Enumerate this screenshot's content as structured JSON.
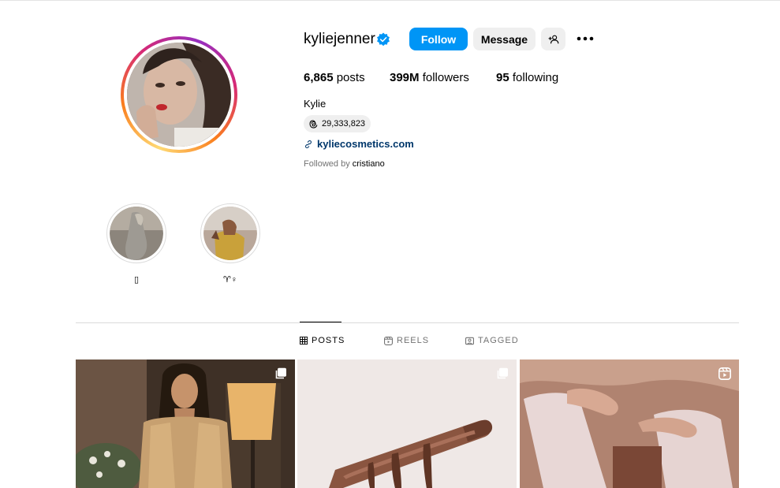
{
  "profile": {
    "username": "kyliejenner",
    "verified_icon": "verified-badge-icon",
    "full_name": "Kylie",
    "threads_count": "29,333,823",
    "link": "kyliecosmetics.com",
    "followed_by_prefix": "Followed by",
    "followed_by_user": "cristiano"
  },
  "actions": {
    "follow_label": "Follow",
    "message_label": "Message",
    "add_user_icon": "add-user-icon",
    "more_icon": "more-options-icon"
  },
  "stats": {
    "posts_num": "6,865",
    "posts_label": "posts",
    "followers_num": "399M",
    "followers_label": "followers",
    "following_num": "95",
    "following_label": "following"
  },
  "highlights": [
    {
      "label": "▯"
    },
    {
      "label": "♈♀"
    }
  ],
  "tabs": [
    {
      "label": "POSTS",
      "icon": "grid-icon",
      "active": true
    },
    {
      "label": "REELS",
      "icon": "reels-icon",
      "active": false
    },
    {
      "label": "TAGGED",
      "icon": "tagged-icon",
      "active": false
    }
  ],
  "posts": [
    {
      "badge_icon": "carousel-icon"
    },
    {
      "badge_icon": "carousel-icon"
    },
    {
      "badge_icon": "reel-icon"
    }
  ],
  "colors": {
    "follow_button": "#0095f6",
    "secondary_button": "#efefef",
    "link": "#00376b",
    "muted_text": "#737373"
  }
}
